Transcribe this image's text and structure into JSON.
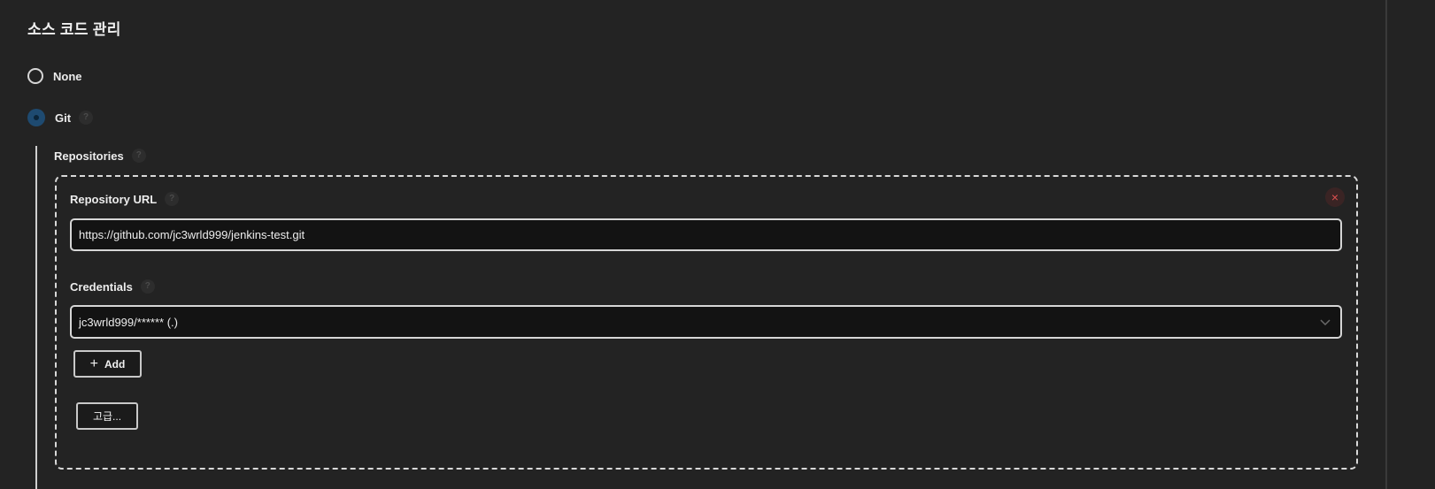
{
  "section": {
    "title": "소스 코드 관리"
  },
  "scm_options": [
    {
      "label": "None",
      "selected": false
    },
    {
      "label": "Git",
      "selected": true
    }
  ],
  "help_glyph": "?",
  "repositories": {
    "label": "Repositories",
    "close_glyph": "×",
    "repository_url": {
      "label": "Repository URL",
      "value": "https://github.com/jc3wrld999/jenkins-test.git"
    },
    "credentials": {
      "label": "Credentials",
      "selected": "jc3wrld999/****** (.)"
    },
    "add_button": {
      "plus": "+",
      "label": "Add"
    },
    "advanced_button": {
      "label": "고급..."
    }
  },
  "colors": {
    "background": "#232323",
    "input_background": "#131313",
    "border": "#d6d6d6",
    "radio_selected": "#1e4a70",
    "close_icon": "#e05252"
  }
}
